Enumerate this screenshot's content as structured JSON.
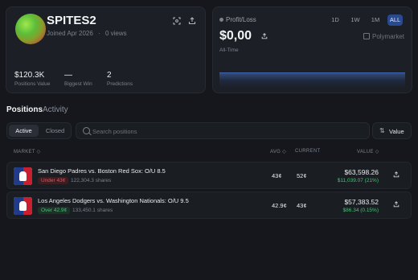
{
  "profile": {
    "username": "SPITES2",
    "joined": "Joined Apr 2026",
    "separator": "·",
    "views": "0 views",
    "icons": {
      "expand": "expand-icon",
      "share": "share-icon"
    },
    "stats": [
      {
        "value": "$120.3K",
        "label": "Positions Value"
      },
      {
        "value": "—",
        "label": "Biggest Win"
      },
      {
        "value": "2",
        "label": "Predictions"
      }
    ]
  },
  "pnl": {
    "title": "Profit/Loss",
    "ranges": [
      "1D",
      "1W",
      "1M",
      "ALL"
    ],
    "active_range": "ALL",
    "value": "$0,00",
    "period": "All-Time",
    "brand": "Polymarket"
  },
  "tabs": {
    "positions": "Positions",
    "activity": "Activity"
  },
  "filters": {
    "active": "Active",
    "closed": "Closed",
    "search_placeholder": "Search positions",
    "sort_label": "Value"
  },
  "columns": {
    "market": "MARKET ◇",
    "avg": "AVG ◇",
    "current": "CURRENT",
    "value": "VALUE ◇"
  },
  "positions": [
    {
      "title": "San Diego Padres vs. Boston Red Sox: O/U 8.5",
      "outcome": "Under 43¢",
      "outcome_color": "red",
      "shares": "122,304.3 shares",
      "avg": "43¢",
      "current": "52¢",
      "value": "$63,598.26",
      "change": "$11,039.07 (21%)"
    },
    {
      "title": "Los Angeles Dodgers vs. Washington Nationals: O/U 9.5",
      "outcome": "Over 42.9¢",
      "outcome_color": "green",
      "shares": "133,450.1 shares",
      "avg": "42.9¢",
      "current": "43¢",
      "value": "$57,383.52",
      "change": "$86.34 (0.15%)"
    }
  ],
  "colors": {
    "accent": "#2a4a8f",
    "positive": "#49c07a",
    "negative": "#e2545f",
    "background": "#15171c"
  }
}
